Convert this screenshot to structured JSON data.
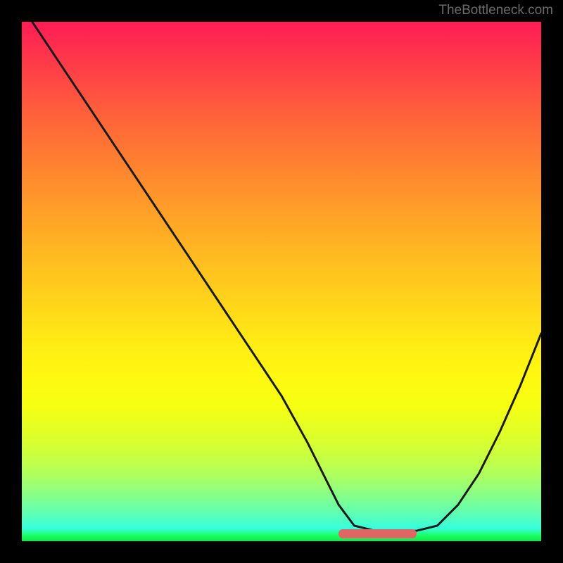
{
  "watermark": "TheBottleneck.com",
  "colors": {
    "page_bg": "#000000",
    "watermark": "#6b6b6b",
    "curve_stroke": "#1a1a1a",
    "accent_bar": "#e06666",
    "gradient_top": "#ff1c55",
    "gradient_bottom": "#0aeb48"
  },
  "chart_data": {
    "type": "line",
    "title": "",
    "xlabel": "",
    "ylabel": "",
    "xlim": [
      0,
      100
    ],
    "ylim": [
      0,
      100
    ],
    "grid": false,
    "legend": false,
    "note": "Axes are unlabeled in the source image; data is normalized 0–100. Higher y = higher in image (top). Curve traces the black line overlaid on the gradient.",
    "series": [
      {
        "name": "bottleneck-curve",
        "x": [
          2.0,
          8,
          14,
          20,
          26,
          32,
          38,
          44,
          50,
          55,
          58,
          61,
          64,
          68,
          72,
          76,
          80,
          84,
          88,
          92,
          96,
          100
        ],
        "values": [
          100,
          91,
          82,
          73,
          64,
          55,
          46,
          37,
          28,
          19,
          13,
          7,
          3,
          2,
          2,
          2,
          3,
          7,
          13,
          21,
          30,
          40
        ]
      }
    ],
    "accent_segment": {
      "x_start": 61,
      "x_end": 76,
      "y": 1.5,
      "description": "Short horizontal bar at the flat valley bottom"
    }
  }
}
